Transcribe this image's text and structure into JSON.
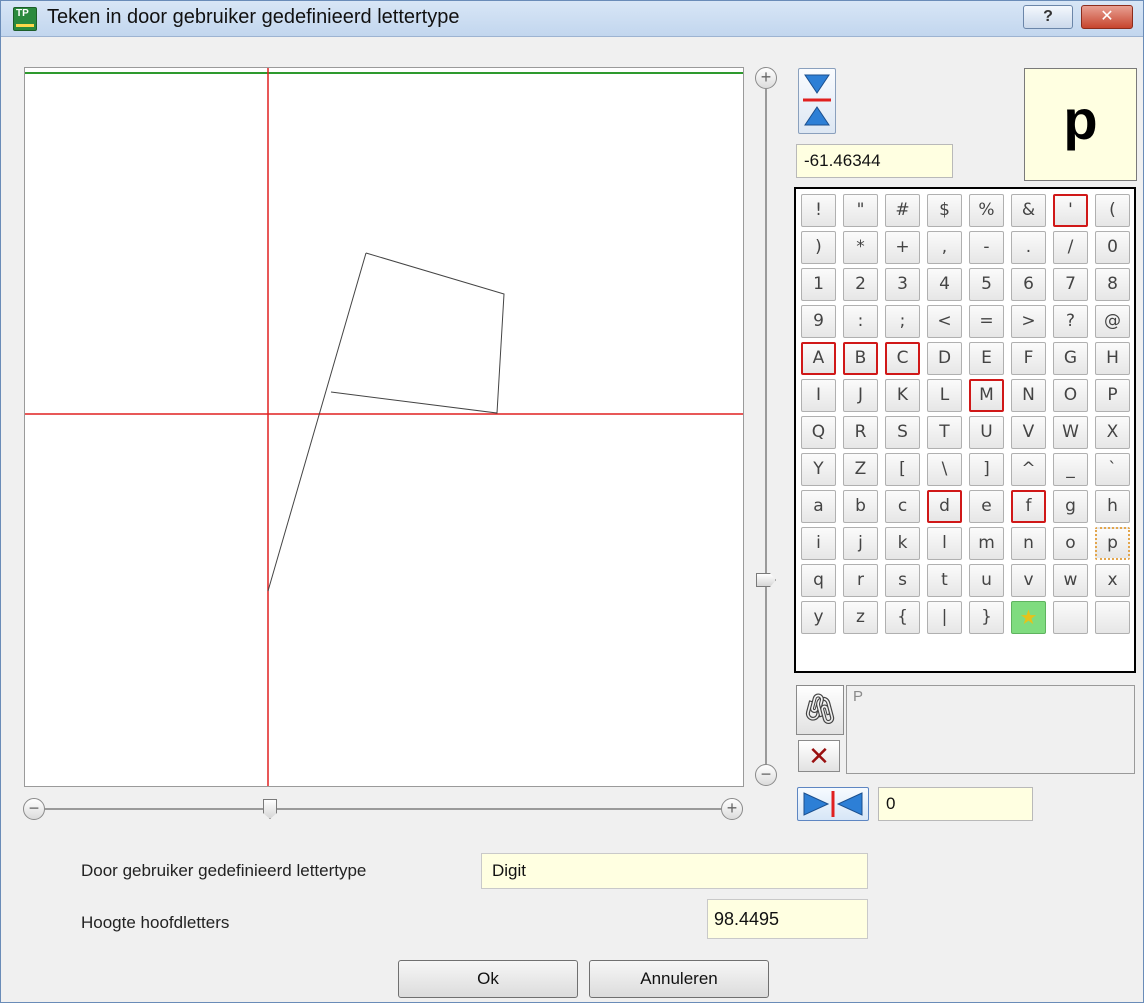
{
  "window": {
    "title": "Teken in door gebruiker gedefinieerd lettertype",
    "help_label": "?",
    "close_label": "✕"
  },
  "colors": {
    "axis": "#e02020",
    "baseline_top": "#2e9a2e",
    "glyph_stroke": "#444444",
    "field_bg": "#ffffe1",
    "marked_border": "#d01818",
    "star_bg": "#7fdc7f"
  },
  "editor": {
    "zoom_in_symbol": "+",
    "zoom_out_symbol": "−"
  },
  "panel": {
    "offset_value": "-61.46344",
    "preview_char": "p",
    "attach_text": "P",
    "attach_icon": "paperclip-icon",
    "delete_icon": "delete-x-icon",
    "delete_symbol": "✕",
    "attach_symbol": "🖇",
    "rotation_value": "0",
    "chars": [
      {
        "c": "!"
      },
      {
        "c": "\""
      },
      {
        "c": "#"
      },
      {
        "c": "$"
      },
      {
        "c": "%"
      },
      {
        "c": "&"
      },
      {
        "c": "'",
        "marked": true
      },
      {
        "c": "("
      },
      {
        "c": ")"
      },
      {
        "c": "*"
      },
      {
        "c": "+"
      },
      {
        "c": ","
      },
      {
        "c": "-"
      },
      {
        "c": "."
      },
      {
        "c": "/"
      },
      {
        "c": "0"
      },
      {
        "c": "1"
      },
      {
        "c": "2"
      },
      {
        "c": "3"
      },
      {
        "c": "4"
      },
      {
        "c": "5"
      },
      {
        "c": "6"
      },
      {
        "c": "7"
      },
      {
        "c": "8"
      },
      {
        "c": "9"
      },
      {
        "c": ":"
      },
      {
        "c": ";"
      },
      {
        "c": "<"
      },
      {
        "c": "="
      },
      {
        "c": ">"
      },
      {
        "c": "?"
      },
      {
        "c": "@"
      },
      {
        "c": "A",
        "marked": true
      },
      {
        "c": "B",
        "marked": true
      },
      {
        "c": "C",
        "marked": true
      },
      {
        "c": "D"
      },
      {
        "c": "E"
      },
      {
        "c": "F"
      },
      {
        "c": "G"
      },
      {
        "c": "H"
      },
      {
        "c": "I"
      },
      {
        "c": "J"
      },
      {
        "c": "K"
      },
      {
        "c": "L"
      },
      {
        "c": "M",
        "marked": true
      },
      {
        "c": "N"
      },
      {
        "c": "O"
      },
      {
        "c": "P"
      },
      {
        "c": "Q"
      },
      {
        "c": "R"
      },
      {
        "c": "S"
      },
      {
        "c": "T"
      },
      {
        "c": "U"
      },
      {
        "c": "V"
      },
      {
        "c": "W"
      },
      {
        "c": "X"
      },
      {
        "c": "Y"
      },
      {
        "c": "Z"
      },
      {
        "c": "["
      },
      {
        "c": "\\"
      },
      {
        "c": "]"
      },
      {
        "c": "^"
      },
      {
        "c": "_"
      },
      {
        "c": "`"
      },
      {
        "c": "a"
      },
      {
        "c": "b"
      },
      {
        "c": "c"
      },
      {
        "c": "d",
        "marked": true
      },
      {
        "c": "e"
      },
      {
        "c": "f",
        "marked": true
      },
      {
        "c": "g"
      },
      {
        "c": "h"
      },
      {
        "c": "i"
      },
      {
        "c": "j"
      },
      {
        "c": "k"
      },
      {
        "c": "l"
      },
      {
        "c": "m"
      },
      {
        "c": "n"
      },
      {
        "c": "o"
      },
      {
        "c": "p",
        "current": true
      },
      {
        "c": "q"
      },
      {
        "c": "r"
      },
      {
        "c": "s"
      },
      {
        "c": "t"
      },
      {
        "c": "u"
      },
      {
        "c": "v"
      },
      {
        "c": "w"
      },
      {
        "c": "x"
      },
      {
        "c": "y"
      },
      {
        "c": "z"
      },
      {
        "c": "{"
      },
      {
        "c": "|"
      },
      {
        "c": "}"
      },
      {
        "c": "★",
        "star": true
      },
      {
        "c": ""
      },
      {
        "c": ""
      }
    ]
  },
  "form": {
    "font_label": "Door gebruiker gedefinieerd lettertype",
    "font_value": "Digit",
    "cap_height_label": "Hoogte hoofdletters",
    "cap_height_value": "98.4495"
  },
  "buttons": {
    "ok": "Ok",
    "cancel": "Annuleren"
  }
}
